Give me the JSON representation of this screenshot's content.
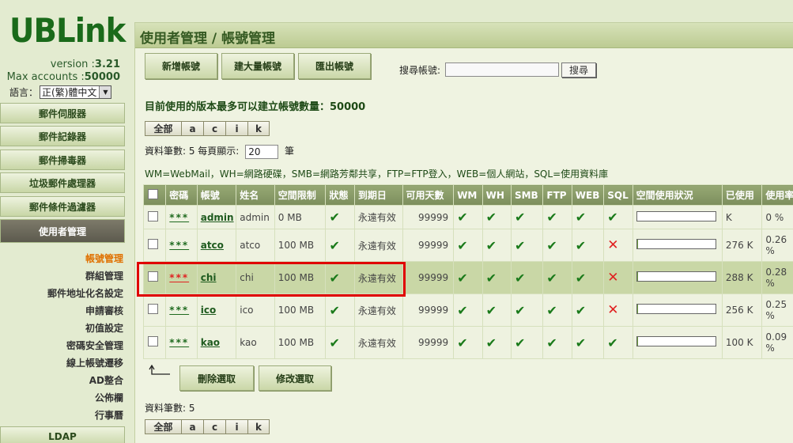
{
  "app": {
    "logo": "UBLink",
    "version_label": "version :",
    "version": "3.21",
    "max_accounts_label": "Max accounts :",
    "max_accounts": "50000",
    "language_label": "語言：",
    "language_value": "正(繁)體中文"
  },
  "sidebar": {
    "menu": [
      {
        "label": "郵件伺服器"
      },
      {
        "label": "郵件記錄器"
      },
      {
        "label": "郵件掃毒器"
      },
      {
        "label": "垃圾郵件處理器"
      },
      {
        "label": "郵件條件過濾器"
      },
      {
        "label": "使用者管理"
      }
    ],
    "submenu": [
      {
        "label": "帳號管理"
      },
      {
        "label": "群組管理"
      },
      {
        "label": "郵件地址化名設定"
      },
      {
        "label": "申請審核"
      },
      {
        "label": "初值設定"
      },
      {
        "label": "密碼安全管理"
      },
      {
        "label": "線上帳號遷移"
      },
      {
        "label": "AD整合"
      },
      {
        "label": "公佈欄"
      },
      {
        "label": "行事曆"
      }
    ],
    "ldap": "LDAP"
  },
  "main": {
    "title": "使用者管理 / 帳號管理",
    "toolbar": {
      "add": "新增帳號",
      "bulk": "建大量帳號",
      "export": "匯出帳號"
    },
    "search": {
      "label": "搜尋帳號:",
      "value": "",
      "button": "搜尋"
    },
    "info": "目前使用的版本最多可以建立帳號數量：50000",
    "letters": [
      "全部",
      "a",
      "c",
      "i",
      "k"
    ],
    "records_label": "資料筆數: 5 每頁顯示:",
    "per_page": "20",
    "records_unit": "筆",
    "legend": "WM=WebMail，WH=網路硬碟，SMB=網路芳鄰共享，FTP=FTP登入，WEB=個人網站，SQL=使用資料庫",
    "columns": [
      "",
      "密碼",
      "帳號",
      "姓名",
      "空間限制",
      "狀態",
      "到期日",
      "可用天數",
      "WM",
      "WH",
      "SMB",
      "FTP",
      "WEB",
      "SQL",
      "空間使用狀況",
      "已使用",
      "使用率"
    ],
    "rows": [
      {
        "pw": "***",
        "account": "admin",
        "name": "admin",
        "quota": "0 MB",
        "expire": "永遠有效",
        "days": "99999",
        "sql": "ok",
        "used": "K",
        "rate": "0 %",
        "usage": 0
      },
      {
        "pw": "***",
        "account": "atco",
        "name": "atco",
        "quota": "100 MB",
        "expire": "永遠有效",
        "days": "99999",
        "sql": "no",
        "used": "276 K",
        "rate": "0.26 %",
        "usage": 0.0026
      },
      {
        "pw": "***",
        "account": "chi",
        "name": "chi",
        "quota": "100 MB",
        "expire": "永遠有效",
        "days": "99999",
        "sql": "no",
        "used": "288 K",
        "rate": "0.28 %",
        "usage": 0.0028
      },
      {
        "pw": "***",
        "account": "ico",
        "name": "ico",
        "quota": "100 MB",
        "expire": "永遠有效",
        "days": "99999",
        "sql": "no",
        "used": "256 K",
        "rate": "0.25 %",
        "usage": 0.0025
      },
      {
        "pw": "***",
        "account": "kao",
        "name": "kao",
        "quota": "100 MB",
        "expire": "永遠有效",
        "days": "99999",
        "sql": "ok",
        "used": "100 K",
        "rate": "0.09 %",
        "usage": 0.0009
      }
    ],
    "actions": {
      "delete": "刪除選取",
      "modify": "修改選取"
    },
    "footer_records": "資料筆數: 5",
    "colors": {
      "accent": "#1a6a1a",
      "highlight": "#e00000"
    }
  }
}
